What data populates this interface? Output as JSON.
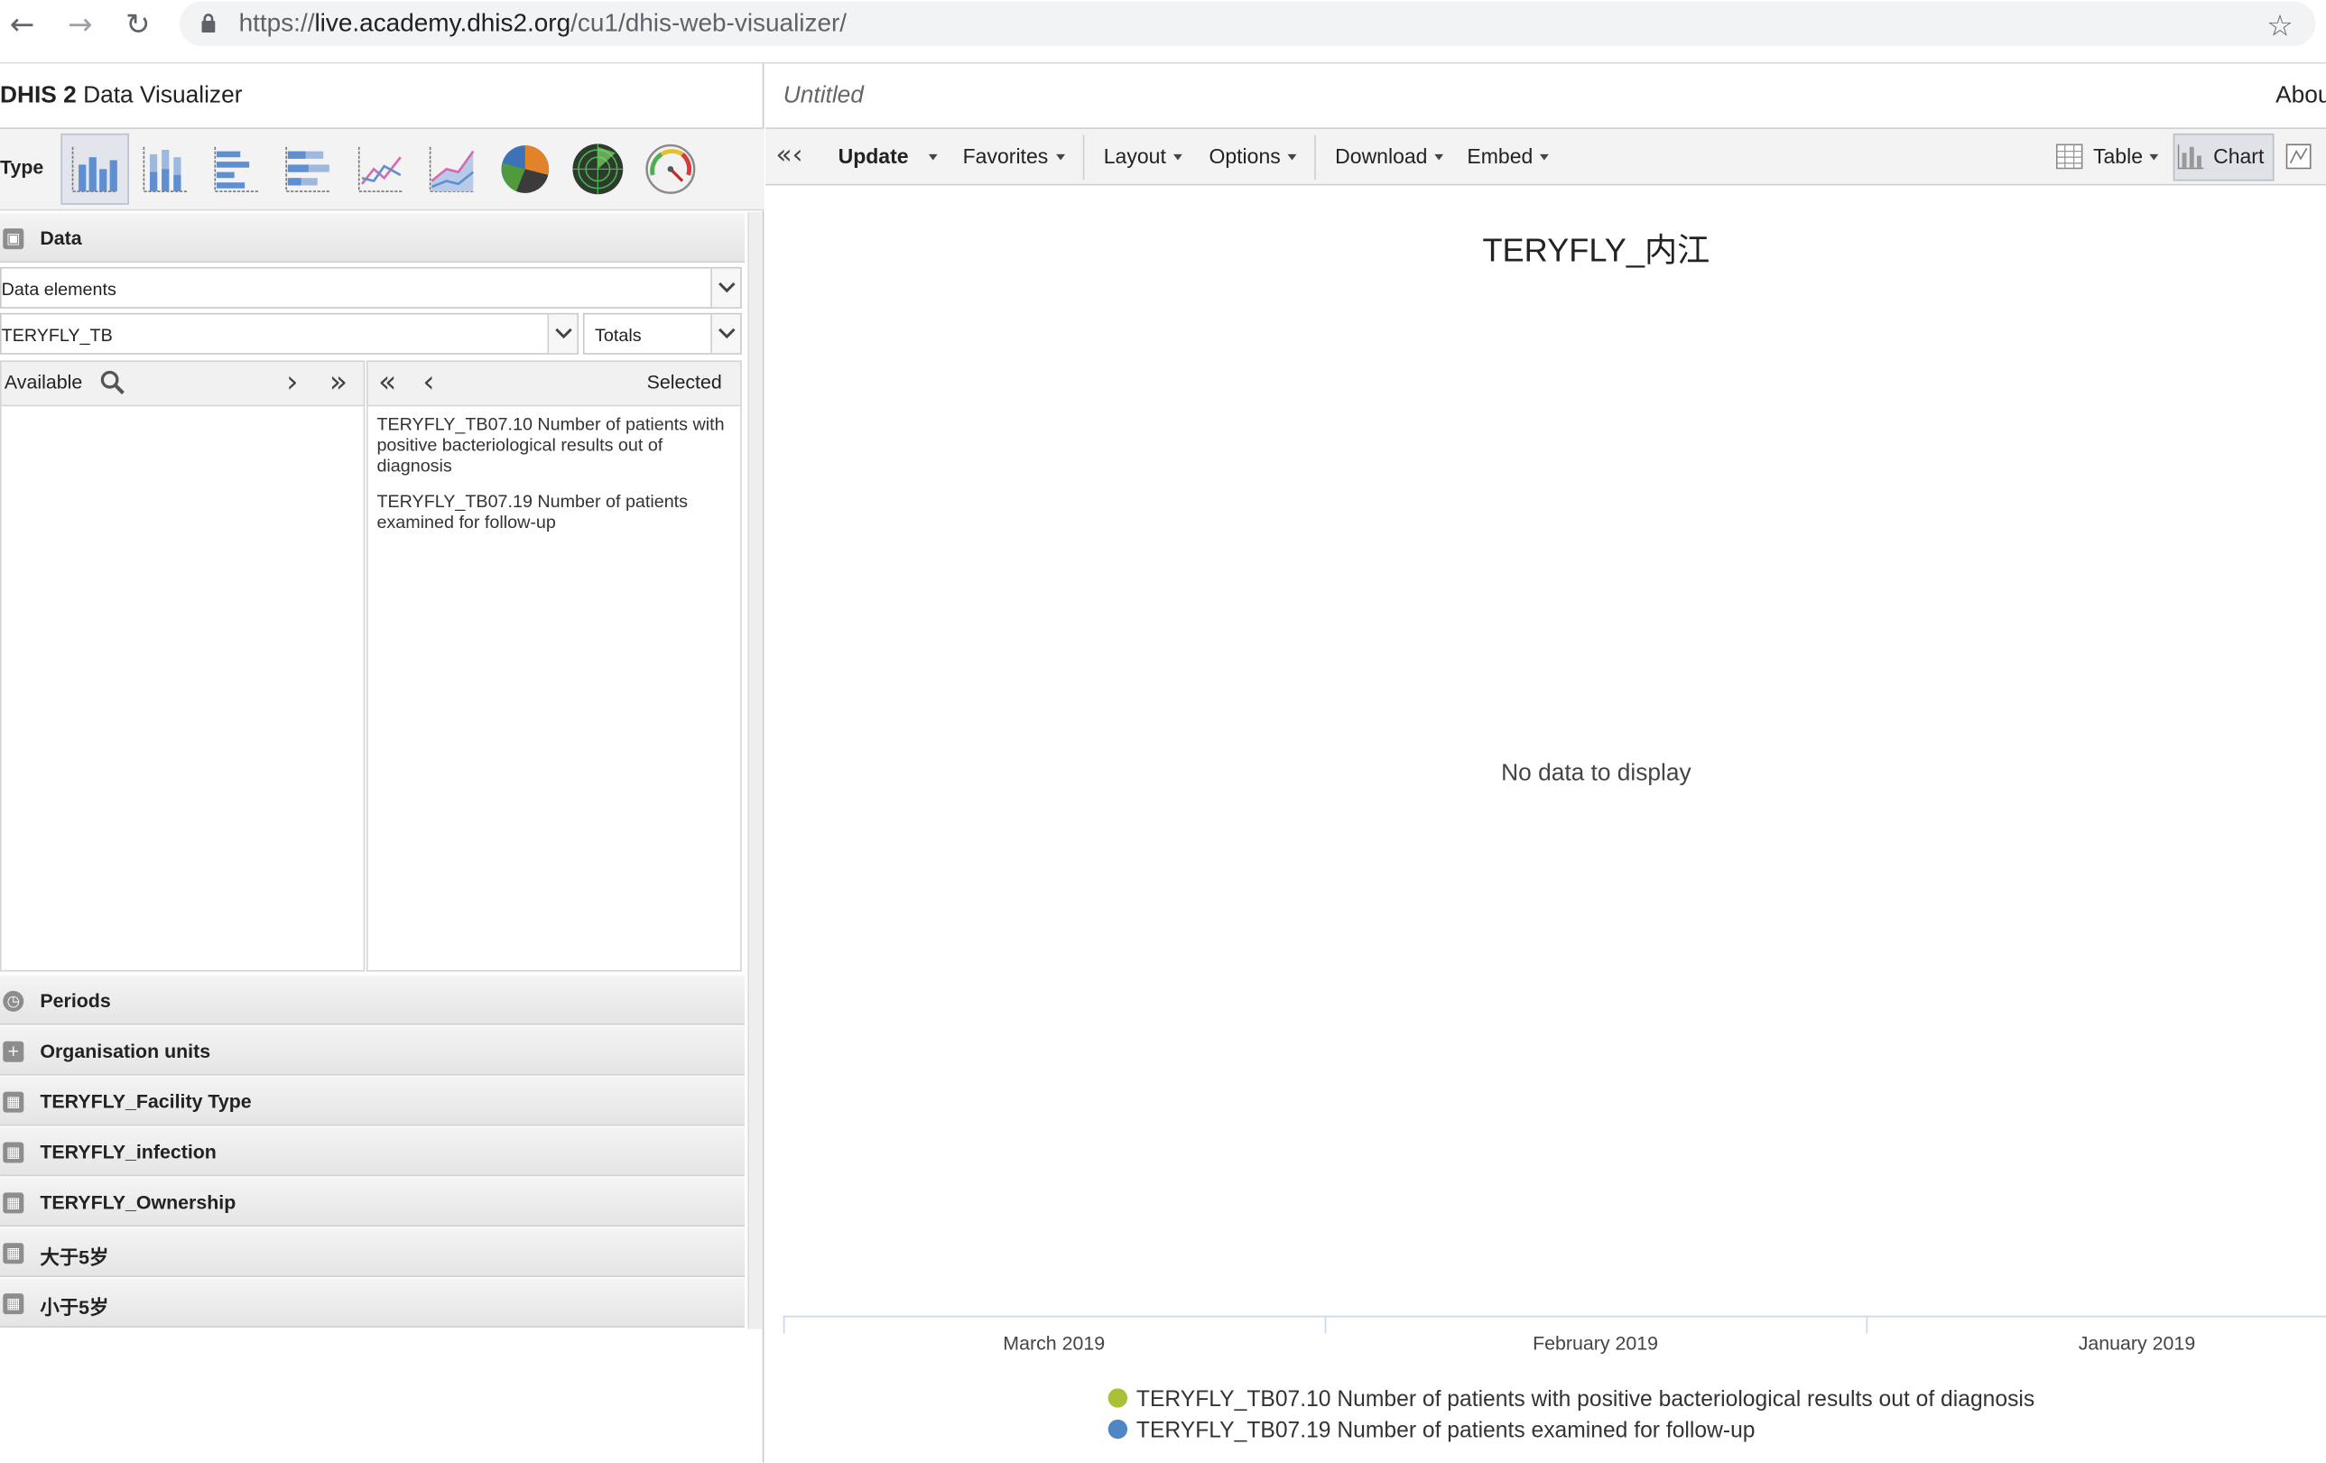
{
  "browser": {
    "url_scheme": "https://",
    "url_host": "live.academy.dhis2.org",
    "url_path": "/cu1/dhis-web-visualizer/"
  },
  "app": {
    "brand": "DHIS 2",
    "name": "Data Visualizer",
    "type_label": "Type",
    "chart_types": [
      "column-chart-icon",
      "stacked-column-chart-icon",
      "bar-chart-icon",
      "stacked-bar-chart-icon",
      "line-chart-icon",
      "area-chart-icon",
      "pie-chart-icon",
      "radar-chart-icon",
      "gauge-chart-icon"
    ]
  },
  "data_panel": {
    "header": "Data",
    "data_type_select": "Data elements",
    "group_select": "TERYFLY_TB",
    "detail_select": "Totals",
    "available_label": "Available",
    "selected_label": "Selected",
    "selected_items": [
      "TERYFLY_TB07.10 Number of patients with positive bacteriological results out of diagnosis",
      "TERYFLY_TB07.19 Number of patients examined for follow-up"
    ]
  },
  "sections": [
    {
      "label": "Periods",
      "icon": "clock-icon"
    },
    {
      "label": "Organisation units",
      "icon": "plus-icon"
    },
    {
      "label": "TERYFLY_Facility Type",
      "icon": "grid-icon"
    },
    {
      "label": "TERYFLY_infection",
      "icon": "grid-icon"
    },
    {
      "label": "TERYFLY_Ownership",
      "icon": "grid-icon"
    },
    {
      "label": "大于5岁",
      "icon": "grid-icon"
    },
    {
      "label": "小于5岁",
      "icon": "grid-icon"
    }
  ],
  "toolbar": {
    "favorite_title": "Untitled",
    "about": "Abou",
    "update": "Update",
    "favorites": "Favorites",
    "layout": "Layout",
    "options": "Options",
    "download": "Download",
    "embed": "Embed",
    "table": "Table",
    "chart": "Chart"
  },
  "chart_data": {
    "type": "column",
    "title": "TERYFLY_内江",
    "message": "No data to display",
    "categories": [
      "March 2019",
      "February 2019",
      "January 2019"
    ],
    "series": [
      {
        "name": "TERYFLY_TB07.10 Number of patients with positive bacteriological results out of diagnosis",
        "color": "#a9c037",
        "values": []
      },
      {
        "name": "TERYFLY_TB07.19 Number of patients examined for follow-up",
        "color": "#4f87c6",
        "values": []
      }
    ]
  }
}
